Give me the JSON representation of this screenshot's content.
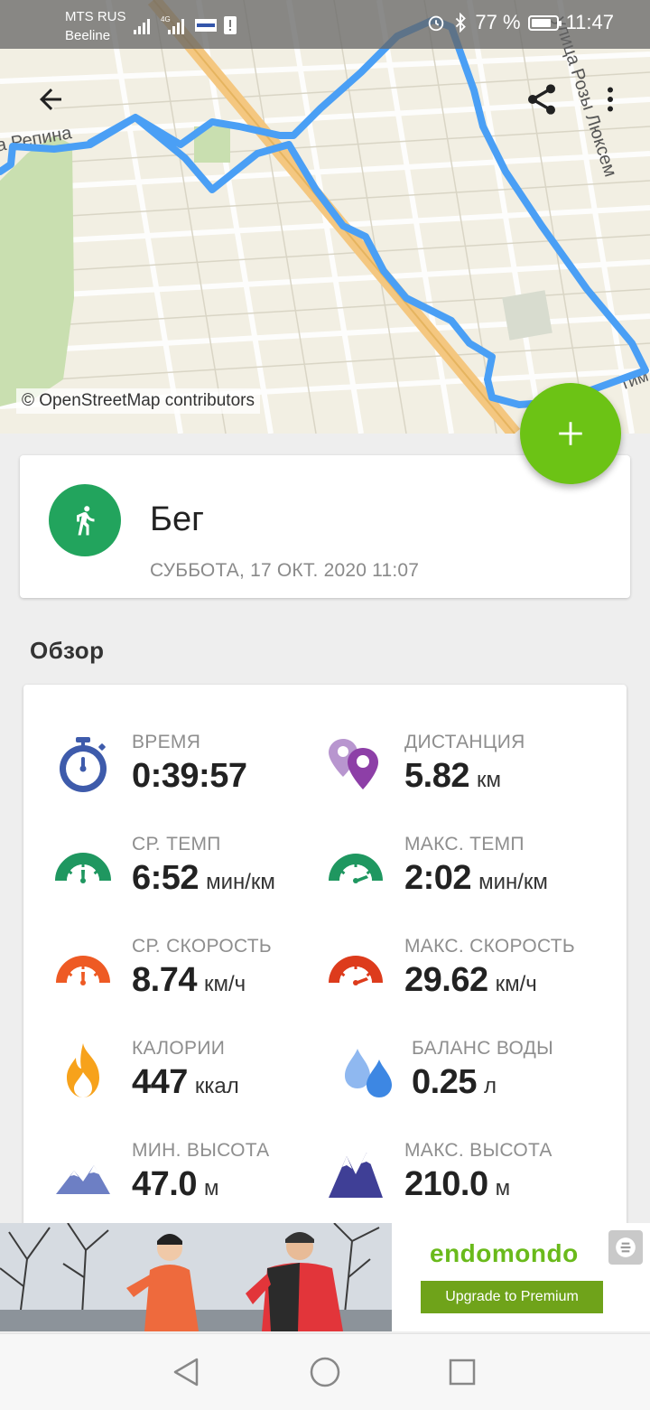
{
  "status_bar": {
    "carrier_1": "MTS RUS",
    "carrier_2": "Beeline",
    "battery": "77 %",
    "time": "11:47"
  },
  "map": {
    "attribution": "© OpenStreetMap contributors",
    "street_label_left": "а Репина",
    "street_label_right": "улица Розы Люксем",
    "street_label_bottom": "Тим",
    "route_color": "#4a9ff5"
  },
  "toolbar": {
    "back_icon": "arrow-left-icon",
    "share_icon": "share-icon",
    "more_icon": "more-vert-icon"
  },
  "fab": {
    "icon": "plus-icon",
    "color": "#6cc315"
  },
  "activity": {
    "name": "Бег",
    "datetime": "СУББОТА, 17 ОКТ. 2020 11:07",
    "icon": "running-person-icon",
    "icon_color": "#22a45d"
  },
  "overview": {
    "title": "Обзор",
    "stats": {
      "time": {
        "label": "ВРЕМЯ",
        "value": "0:39:57",
        "unit": ""
      },
      "distance": {
        "label": "ДИСТАНЦИЯ",
        "value": "5.82",
        "unit": "км"
      },
      "avg_pace": {
        "label": "СР. ТЕМП",
        "value": "6:52",
        "unit": "мин/км"
      },
      "max_pace": {
        "label": "МАКС. ТЕМП",
        "value": "2:02",
        "unit": "мин/км"
      },
      "avg_speed": {
        "label": "СР. СКОРОСТЬ",
        "value": "8.74",
        "unit": "км/ч"
      },
      "max_speed": {
        "label": "МАКС. СКОРОСТЬ",
        "value": "29.62",
        "unit": "км/ч"
      },
      "calories": {
        "label": "КАЛОРИИ",
        "value": "447",
        "unit": "ккал"
      },
      "water": {
        "label": "БАЛАНС ВОДЫ",
        "value": "0.25",
        "unit": "л"
      },
      "min_altitude": {
        "label": "МИН. ВЫСОТА",
        "value": "47.0",
        "unit": "м"
      },
      "max_altitude": {
        "label": "МАКС. ВЫСОТА",
        "value": "210.0",
        "unit": "м"
      }
    }
  },
  "ad": {
    "brand": "endomondo",
    "cta": "Upgrade to Premium"
  },
  "nav": {
    "back_icon": "triangle-back-icon",
    "home_icon": "circle-home-icon",
    "recents_icon": "square-recents-icon"
  }
}
